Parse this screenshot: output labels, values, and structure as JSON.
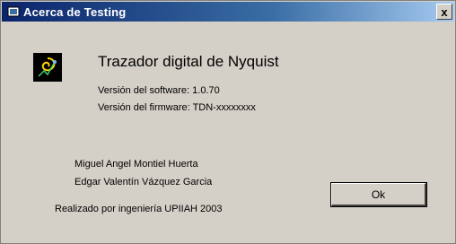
{
  "window": {
    "title": "Acerca de Testing",
    "close_glyph": "x"
  },
  "app": {
    "name": "Trazador digital de Nyquist",
    "icon": "nyquist-app-icon"
  },
  "version": {
    "line1": "Versión del software: 1.0.70",
    "line2": "Versión del firmware: TDN-xxxxxxxx"
  },
  "authors": {
    "line1": "Miguel Angel Montiel Huerta",
    "line2": "Edgar Valentín Vázquez Garcia"
  },
  "footer": "Realizado por ingeniería UPIIAH 2003",
  "buttons": {
    "ok_label": "Ok"
  },
  "colors": {
    "titlebar_start": "#0a246a",
    "titlebar_end": "#a6caf0",
    "dialog_bg": "#d4d0c8"
  }
}
